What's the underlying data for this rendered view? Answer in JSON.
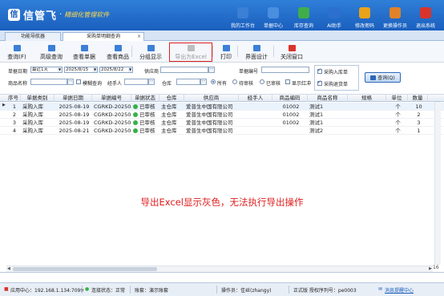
{
  "header": {
    "brand": "信管飞",
    "subtitle": "精细化管理软件",
    "nav": [
      {
        "label": "我的工作台",
        "icon": "monitor-icon",
        "color": "#3b7fd6"
      },
      {
        "label": "单据中心",
        "icon": "document-list-icon",
        "color": "#4a8ee0"
      },
      {
        "label": "库存查询",
        "icon": "box-search-icon",
        "color": "#3fae4a"
      },
      {
        "label": "AI助手",
        "icon": "info-icon",
        "color": "#2d6fcf"
      },
      {
        "label": "修改密码",
        "icon": "lock-icon",
        "color": "#e8a21c"
      },
      {
        "label": "更换操作员",
        "icon": "user-icon",
        "color": "#e0822a"
      },
      {
        "label": "退出系统",
        "icon": "close-icon",
        "color": "#d9342b"
      }
    ]
  },
  "tabs": [
    {
      "label": "功能导航器",
      "active": false
    },
    {
      "label": "采购单明细查询",
      "active": true,
      "close": "×"
    }
  ],
  "toolbar": [
    {
      "label": "查询(F)",
      "icon": "query-icon",
      "color": "#3b7fd6",
      "disabled": false
    },
    {
      "label": "高级查询",
      "icon": "advanced-query-icon",
      "color": "#3b7fd6",
      "disabled": false
    },
    {
      "label": "查看单据",
      "icon": "view-document-icon",
      "color": "#3b7fd6",
      "disabled": false
    },
    {
      "label": "查看商品",
      "icon": "view-product-icon",
      "color": "#3b7fd6",
      "disabled": false
    },
    {
      "label": "分组显示",
      "icon": "group-display-icon",
      "color": "#3b7fd6",
      "disabled": false
    },
    {
      "label": "导出为Excel",
      "icon": "excel-export-icon",
      "color": "#2e8b3e",
      "disabled": true
    },
    {
      "label": "打印",
      "icon": "print-icon",
      "color": "#3b7fd6",
      "disabled": false
    },
    {
      "label": "界面设计",
      "icon": "layout-design-icon",
      "color": "#3b7fd6",
      "disabled": false
    },
    {
      "label": "关闭窗口",
      "icon": "close-window-icon",
      "color": "#d9342b",
      "disabled": false
    }
  ],
  "filters": {
    "date_label": "单据日期",
    "date_range": "最近1天",
    "date_from": "2025/8/15",
    "date_to": "2025/8/22",
    "supplier_label": "供应商",
    "doc_no_label": "单据编号",
    "product_label": "商品名称",
    "fuzzy_label": "模糊查询",
    "fuzzy_checked": false,
    "handler_label": "经手人",
    "warehouse_label": "仓库",
    "status_all": "所有",
    "status_pending": "待审核",
    "status_approved": "已审核",
    "show_red": "显示红冲",
    "purchase_in": "采购入库单",
    "purchase_in_checked": true,
    "purchase_return": "采购退货单",
    "purchase_return_checked": true,
    "query_btn": "查询(Q)"
  },
  "grid": {
    "columns": [
      "序号",
      "单据类别",
      "单据日期",
      "单据编号",
      "单据状态",
      "仓库",
      "供应商",
      "经手人",
      "商品编码",
      "商品名称",
      "规格",
      "单位",
      "数量"
    ],
    "rows": [
      {
        "no": "1",
        "type": "采购入库",
        "date": "2025-08-19",
        "doc": "CGRKD-20250819",
        "status": "已审核",
        "wh": "主仓库",
        "supplier": "爱普生中国有限公司",
        "handler": "",
        "code": "01002",
        "name": "测试1",
        "spec": "",
        "unit": "个",
        "qty": "10"
      },
      {
        "no": "2",
        "type": "采购入库",
        "date": "2025-08-19",
        "doc": "CGRKD-20250819",
        "status": "已审核",
        "wh": "主仓库",
        "supplier": "爱普生中国有限公司",
        "handler": "",
        "code": "01002",
        "name": "测试1",
        "spec": "",
        "unit": "个",
        "qty": "2"
      },
      {
        "no": "3",
        "type": "采购入库",
        "date": "2025-08-19",
        "doc": "CGRKD-20250819",
        "status": "已审核",
        "wh": "主仓库",
        "supplier": "爱普生中国有限公司",
        "handler": "",
        "code": "01002",
        "name": "测试1",
        "spec": "",
        "unit": "个",
        "qty": "3"
      },
      {
        "no": "4",
        "type": "采购入库",
        "date": "2025-08-21",
        "doc": "CGRKD-20250821",
        "status": "已审核",
        "wh": "主仓库",
        "supplier": "爱普生中国有限公司",
        "handler": "",
        "code": "",
        "name": "测试2",
        "spec": "",
        "unit": "个",
        "qty": "1"
      }
    ],
    "status_color": "#35b245",
    "total_count": "16"
  },
  "annotation": "导出Excel显示灰色，无法执行导出操作",
  "statusbar": {
    "center": "应用中心：192.168.1.134:7099",
    "conn": "连接状态：正常",
    "account": "账套：演示账套",
    "operator": "操作员：佳丝(zhangy)",
    "license": "正式版 授权序列号：pe0003",
    "link": "消息提醒中心"
  }
}
